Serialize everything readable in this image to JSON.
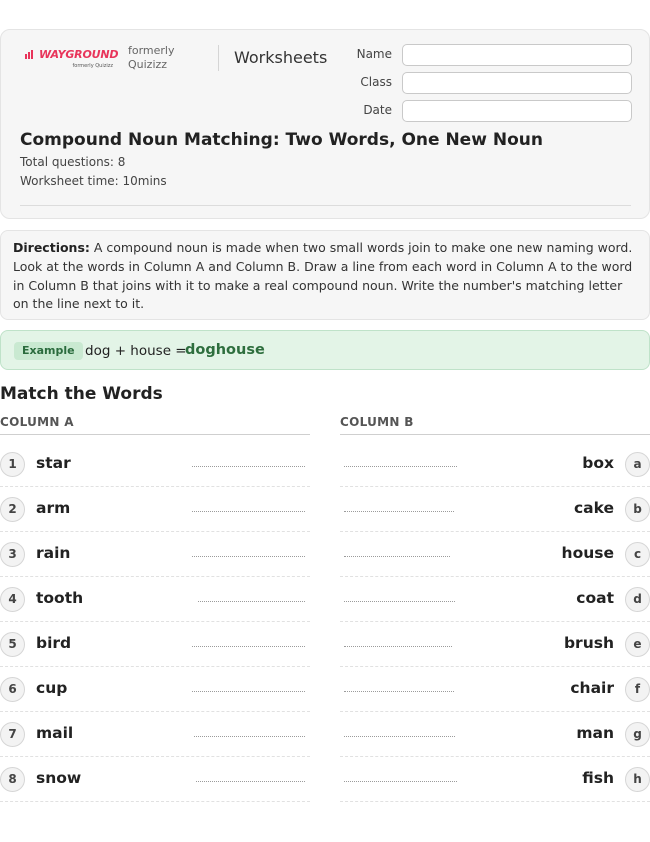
{
  "header": {
    "logo_text": "WAYGROUND",
    "logo_subtext": "formerly Quizizz",
    "formerly_text": "formerly Quizizz",
    "section_label": "Worksheets",
    "fields": [
      {
        "label": "Name",
        "value": ""
      },
      {
        "label": "Class",
        "value": ""
      },
      {
        "label": "Date",
        "value": ""
      }
    ]
  },
  "worksheet": {
    "title": "Compound Noun Matching: Two Words, One New Noun",
    "total_questions": "Total questions: 8",
    "worksheet_time": "Worksheet time: 10mins"
  },
  "directions": {
    "label": "Directions:",
    "text": "A compound noun is made when two small words join to make one new naming word. Look at the words in Column A and Column B. Draw a line from each word in Column A to the word in Column B that joins with it to make a real compound noun. Write the number's matching letter on the line next to it."
  },
  "example": {
    "badge": "Example",
    "prompt": "dog + house =",
    "answer": "doghouse"
  },
  "matching": {
    "title": "Match the Words",
    "column_a_header": "COLUMN A",
    "column_b_header": "COLUMN B",
    "column_a": [
      {
        "num": "1",
        "word": "star"
      },
      {
        "num": "2",
        "word": "arm"
      },
      {
        "num": "3",
        "word": "rain"
      },
      {
        "num": "4",
        "word": "tooth"
      },
      {
        "num": "5",
        "word": "bird"
      },
      {
        "num": "6",
        "word": "cup"
      },
      {
        "num": "7",
        "word": "mail"
      },
      {
        "num": "8",
        "word": "snow"
      }
    ],
    "column_b": [
      {
        "letter": "a",
        "word": "box"
      },
      {
        "letter": "b",
        "word": "cake"
      },
      {
        "letter": "c",
        "word": "house"
      },
      {
        "letter": "d",
        "word": "coat"
      },
      {
        "letter": "e",
        "word": "brush"
      },
      {
        "letter": "f",
        "word": "chair"
      },
      {
        "letter": "g",
        "word": "man"
      },
      {
        "letter": "h",
        "word": "fish"
      }
    ]
  },
  "colors": {
    "brand": "#e8345a",
    "example_bg": "#e3f4e7",
    "example_answer": "#2e6e3e"
  }
}
